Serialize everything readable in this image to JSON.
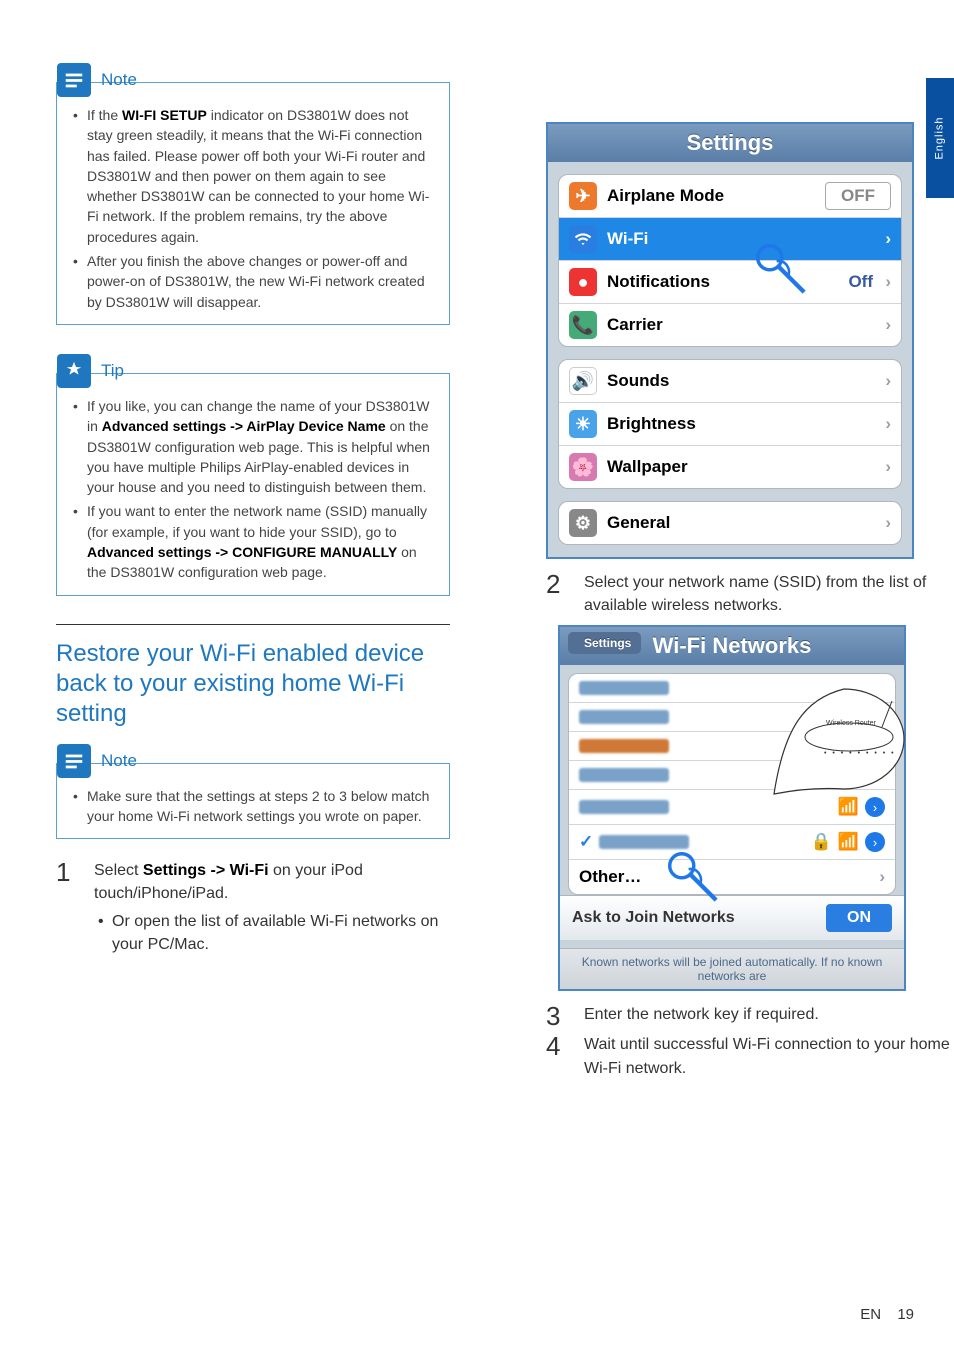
{
  "language_tab": "English",
  "note_label": "Note",
  "tip_label": "Tip",
  "callout_note1": [
    "If the <b>WI-FI SETUP</b> indicator on DS3801W does not stay green steadily, it means that the Wi-Fi connection has failed. Please power off both your Wi-Fi router and DS3801W and then power on them again to see whether DS3801W can be connected to your home Wi-Fi network. If the problem remains, try the above procedures again.",
    "After you finish the above changes or power-off and power-on of DS3801W, the new Wi-Fi network created by DS3801W will disappear."
  ],
  "callout_tip": [
    "If you like, you can change the name of your DS3801W in <b>Advanced settings -> AirPlay Device Name</b> on the DS3801W configuration web page. This is helpful when you have multiple Philips AirPlay-enabled devices in your house and you need to distinguish between them.",
    "If you want to enter the network name (SSID) manually (for example, if you want to hide your SSID), go to <b>Advanced settings -> CONFIGURE MANUALLY</b> on the DS3801W configuration web page."
  ],
  "heading": "Restore your Wi-Fi enabled device back to your existing home Wi-Fi setting",
  "callout_note2": [
    "Make sure that the settings at steps 2 to 3 below match your home Wi-Fi network settings you wrote on paper."
  ],
  "steps": {
    "s1": {
      "num": "1",
      "text": "Select <b>Settings -> Wi-Fi</b> on your iPod touch/iPhone/iPad.",
      "sub": [
        "Or open the list of available Wi-Fi networks on your PC/Mac."
      ]
    },
    "s2": {
      "num": "2",
      "text": "Select your network name (SSID) from the list of available wireless networks."
    },
    "s3": {
      "num": "3",
      "text": "Enter the network key if required."
    },
    "s4": {
      "num": "4",
      "text": "Wait until successful Wi-Fi connection to your home Wi-Fi network."
    }
  },
  "ios1": {
    "title": "Settings",
    "rows": {
      "airplane": "Airplane Mode",
      "airplane_val": "OFF",
      "wifi": "Wi-Fi",
      "notif": "Notifications",
      "notif_val": "Off",
      "carrier": "Carrier",
      "sounds": "Sounds",
      "brightness": "Brightness",
      "wallpaper": "Wallpaper",
      "general": "General"
    }
  },
  "ios2": {
    "back": "Settings",
    "title": "Wi-Fi Networks",
    "other": "Other…",
    "ask": "Ask to Join Networks",
    "ask_val": "ON",
    "foot": "Known networks will be joined automatically. If no known networks are"
  },
  "footer": {
    "lang": "EN",
    "page": "19"
  }
}
